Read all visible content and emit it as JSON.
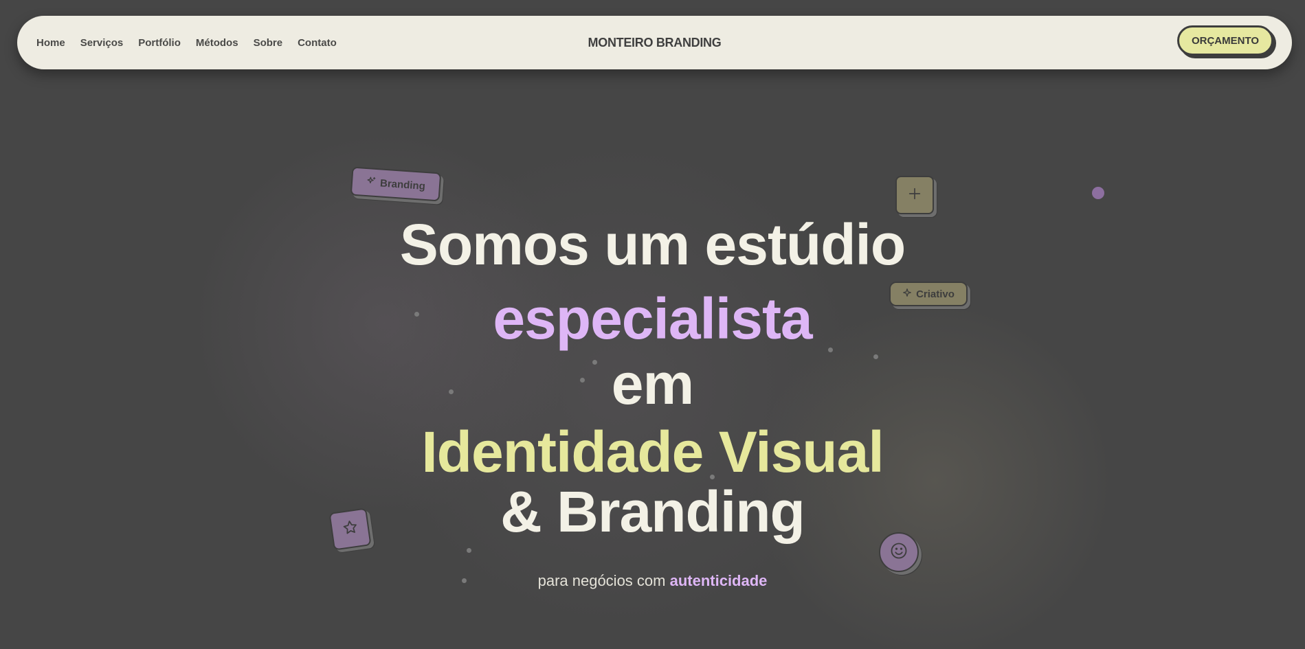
{
  "nav": {
    "links": [
      "Home",
      "Serviços",
      "Portfólio",
      "Métodos",
      "Sobre",
      "Contato"
    ],
    "brand": "MONTEIRO BRANDING",
    "cta": "ORÇAMENTO"
  },
  "hero": {
    "line1": "Somos um estúdio",
    "line2": "especialista",
    "line3": "em",
    "line4": "Identidade Visual",
    "line5": "& Branding",
    "subtitle_prefix": "para negócios com ",
    "subtitle_accent": "autenticidade"
  },
  "tags": {
    "branding": "Branding",
    "criativo": "Criativo"
  },
  "icons": {
    "branding_tag": "sparkles-icon",
    "criativo_tag": "sparkle-icon",
    "plus": "plus-icon",
    "star": "star-icon",
    "smile": "smile-icon"
  },
  "colors": {
    "background": "#464646",
    "navbar": "#eeece2",
    "cta": "#e6e8a0",
    "lavender": "#deb6f6",
    "lime": "#e6e89c",
    "cream": "#f3f1e6"
  }
}
